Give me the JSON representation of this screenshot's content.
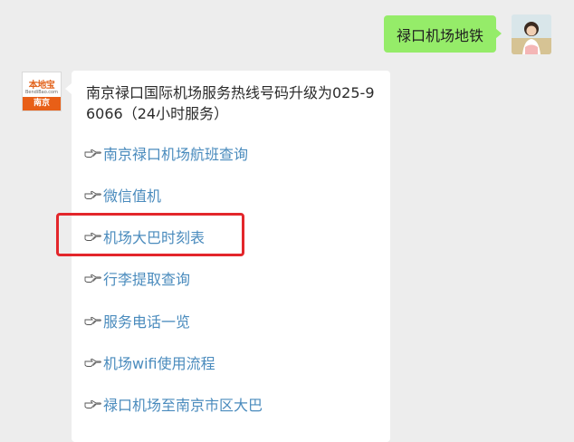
{
  "conversation": {
    "outgoing_message": "禄口机场地铁",
    "bot_avatar": {
      "brand_text": "本地宝",
      "site_text": "BendiBao.com",
      "city_text": "南京"
    },
    "reply": {
      "intro": "南京禄口国际机场服务热线号码升级为025-96066（24小时服务）",
      "links": [
        {
          "label": "南京禄口机场航班查询",
          "icon": "pointing-hand-icon"
        },
        {
          "label": "微信值机",
          "icon": "pointing-hand-icon"
        },
        {
          "label": "机场大巴时刻表",
          "icon": "pointing-hand-icon",
          "highlighted": true
        },
        {
          "label": "行李提取查询",
          "icon": "pointing-hand-icon"
        },
        {
          "label": "服务电话一览",
          "icon": "pointing-hand-icon"
        },
        {
          "label": "机场wifi使用流程",
          "icon": "pointing-hand-icon"
        },
        {
          "label": "禄口机场至南京市区大巴",
          "icon": "pointing-hand-icon"
        }
      ]
    }
  },
  "colors": {
    "background": "#ededed",
    "outgoing_bubble": "#95ec69",
    "link": "#4a8bbd",
    "highlight": "#e3262b",
    "brand_orange": "#e85f17"
  }
}
